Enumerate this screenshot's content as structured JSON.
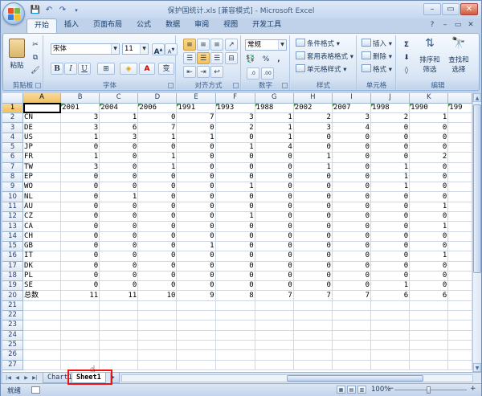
{
  "window": {
    "title": "保护国统计.xls  [兼容模式]  -  Microsoft Excel",
    "controls": {
      "minimize": "–",
      "maximize": "▭",
      "close": "✕"
    }
  },
  "qat": {
    "save_icon": "save-icon",
    "undo_icon": "undo-icon",
    "redo_icon": "redo-icon"
  },
  "ribbon_tabs": [
    "开始",
    "插入",
    "页面布局",
    "公式",
    "数据",
    "审阅",
    "视图",
    "开发工具"
  ],
  "ribbon": {
    "clipboard": {
      "label": "剪贴板",
      "paste": "粘贴"
    },
    "font": {
      "label": "字体",
      "font_name": "宋体",
      "font_size": "11",
      "bold": "B",
      "italic": "I",
      "underline": "U",
      "grow": "A",
      "shrink": "A"
    },
    "alignment": {
      "label": "对齐方式"
    },
    "number": {
      "label": "数字",
      "format": "常规",
      "percent": "%",
      "comma": ","
    },
    "styles": {
      "label": "样式",
      "conditional": "条件格式",
      "table_format": "套用表格格式",
      "cell_styles": "单元格样式"
    },
    "cells": {
      "label": "单元格",
      "insert": "插入",
      "delete": "删除",
      "format": "格式"
    },
    "editing": {
      "label": "编辑",
      "sort": "排序和",
      "sort2": "筛选",
      "find": "查找和",
      "find2": "选择",
      "sum": "Σ"
    }
  },
  "grid": {
    "columns": [
      "A",
      "B",
      "C",
      "D",
      "E",
      "F",
      "G",
      "H",
      "I",
      "J",
      "K"
    ],
    "header_row": [
      "",
      "2001",
      "2004",
      "2006",
      "1991",
      "1993",
      "1988",
      "2002",
      "2007",
      "1998",
      "1990",
      "199"
    ],
    "rows": [
      [
        "CN",
        "3",
        "1",
        "0",
        "7",
        "3",
        "1",
        "2",
        "3",
        "2",
        "1"
      ],
      [
        "DE",
        "3",
        "6",
        "7",
        "0",
        "2",
        "1",
        "3",
        "4",
        "0",
        "0"
      ],
      [
        "US",
        "1",
        "3",
        "1",
        "1",
        "0",
        "1",
        "0",
        "0",
        "0",
        "0"
      ],
      [
        "JP",
        "0",
        "0",
        "0",
        "0",
        "1",
        "4",
        "0",
        "0",
        "0",
        "0"
      ],
      [
        "FR",
        "1",
        "0",
        "1",
        "0",
        "0",
        "0",
        "1",
        "0",
        "0",
        "2"
      ],
      [
        "TW",
        "3",
        "0",
        "1",
        "0",
        "0",
        "0",
        "1",
        "0",
        "1",
        "0"
      ],
      [
        "EP",
        "0",
        "0",
        "0",
        "0",
        "0",
        "0",
        "0",
        "0",
        "1",
        "0"
      ],
      [
        "WO",
        "0",
        "0",
        "0",
        "0",
        "1",
        "0",
        "0",
        "0",
        "1",
        "0"
      ],
      [
        "NL",
        "0",
        "1",
        "0",
        "0",
        "0",
        "0",
        "0",
        "0",
        "0",
        "0"
      ],
      [
        "AU",
        "0",
        "0",
        "0",
        "0",
        "0",
        "0",
        "0",
        "0",
        "0",
        "1"
      ],
      [
        "CZ",
        "0",
        "0",
        "0",
        "0",
        "1",
        "0",
        "0",
        "0",
        "0",
        "0"
      ],
      [
        "CA",
        "0",
        "0",
        "0",
        "0",
        "0",
        "0",
        "0",
        "0",
        "0",
        "1"
      ],
      [
        "CH",
        "0",
        "0",
        "0",
        "0",
        "0",
        "0",
        "0",
        "0",
        "0",
        "0"
      ],
      [
        "GB",
        "0",
        "0",
        "0",
        "1",
        "0",
        "0",
        "0",
        "0",
        "0",
        "0"
      ],
      [
        "IT",
        "0",
        "0",
        "0",
        "0",
        "0",
        "0",
        "0",
        "0",
        "0",
        "1"
      ],
      [
        "DK",
        "0",
        "0",
        "0",
        "0",
        "0",
        "0",
        "0",
        "0",
        "0",
        "0"
      ],
      [
        "PL",
        "0",
        "0",
        "0",
        "0",
        "0",
        "0",
        "0",
        "0",
        "0",
        "0"
      ],
      [
        "SE",
        "0",
        "0",
        "0",
        "0",
        "0",
        "0",
        "0",
        "0",
        "1",
        "0"
      ],
      [
        "总数",
        "11",
        "11",
        "10",
        "9",
        "8",
        "7",
        "7",
        "7",
        "6",
        "6"
      ]
    ],
    "row_numbers": [
      "1",
      "2",
      "3",
      "4",
      "5",
      "6",
      "7",
      "8",
      "9",
      "10",
      "11",
      "12",
      "13",
      "14",
      "15",
      "16",
      "17",
      "18",
      "19",
      "20",
      "21",
      "22",
      "23",
      "24",
      "25",
      "26",
      "27"
    ]
  },
  "sheet_tabs": [
    "Chart1",
    "Sheet1"
  ],
  "active_sheet": "Sheet1",
  "status": {
    "text": "就绪",
    "zoom": "100%"
  },
  "colors": {
    "accent": "#f1c05c",
    "highlight_box": "#ee1111",
    "grid_line": "#d0d7e5"
  }
}
